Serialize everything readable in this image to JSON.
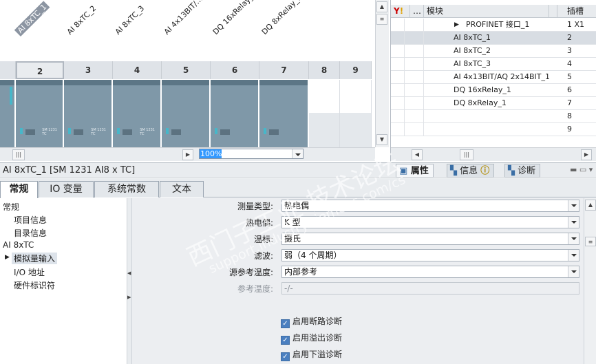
{
  "device_view": {
    "module_labels": [
      "AI 8xTC_1",
      "AI 8xTC_2",
      "AI 8xTC_3",
      "AI 4x13BIT/...",
      "DQ 16xRelay_...",
      "DQ 8xRelay_..."
    ],
    "slot_numbers": [
      "2",
      "3",
      "4",
      "5",
      "6",
      "7",
      "8",
      "9"
    ],
    "module_caption": "SM 1231\nTC",
    "zoom": "100%"
  },
  "overview": {
    "headers": {
      "module": "模块",
      "slot": "插槽"
    },
    "rows": [
      {
        "module": "PROFINET 接口_1",
        "slot": "1 X1",
        "indent": true
      },
      {
        "module": "AI 8xTC_1",
        "slot": "2",
        "selected": true
      },
      {
        "module": "AI 8xTC_2",
        "slot": "3"
      },
      {
        "module": "AI 8xTC_3",
        "slot": "4"
      },
      {
        "module": "AI 4x13BIT/AQ 2x14BIT_1",
        "slot": "5"
      },
      {
        "module": "DQ 16xRelay_1",
        "slot": "6"
      },
      {
        "module": "DQ 8xRelay_1",
        "slot": "7"
      },
      {
        "module": "",
        "slot": "8"
      },
      {
        "module": "",
        "slot": "9"
      }
    ]
  },
  "properties": {
    "title": "AI 8xTC_1 [SM 1231 AI8 x TC]",
    "panel_tabs": [
      "属性",
      "信息",
      "诊断"
    ],
    "tabs": [
      "常规",
      "IO 变量",
      "系统常数",
      "文本"
    ]
  },
  "tree": {
    "items": [
      "常规",
      "项目信息",
      "目录信息",
      "AI 8xTC",
      "模拟量输入",
      "I/O 地址",
      "硬件标识符"
    ]
  },
  "form": {
    "fields": [
      {
        "label": "测量类型:",
        "value": "热电偶"
      },
      {
        "label": "热电偶:",
        "value": "K 型"
      },
      {
        "label": "温标:",
        "value": "摄氏"
      },
      {
        "label": "滤波:",
        "value": "弱（4 个周期）"
      },
      {
        "label": "源参考温度:",
        "value": "内部参考"
      },
      {
        "label": "参考温度:",
        "value": "-/-"
      }
    ],
    "checkboxes": [
      "启用断路诊断",
      "启用溢出诊断",
      "启用下溢诊断"
    ]
  },
  "watermark": {
    "line1": "西门子工业 技术论坛",
    "line2": "support.industry.siemens.com/cs"
  }
}
